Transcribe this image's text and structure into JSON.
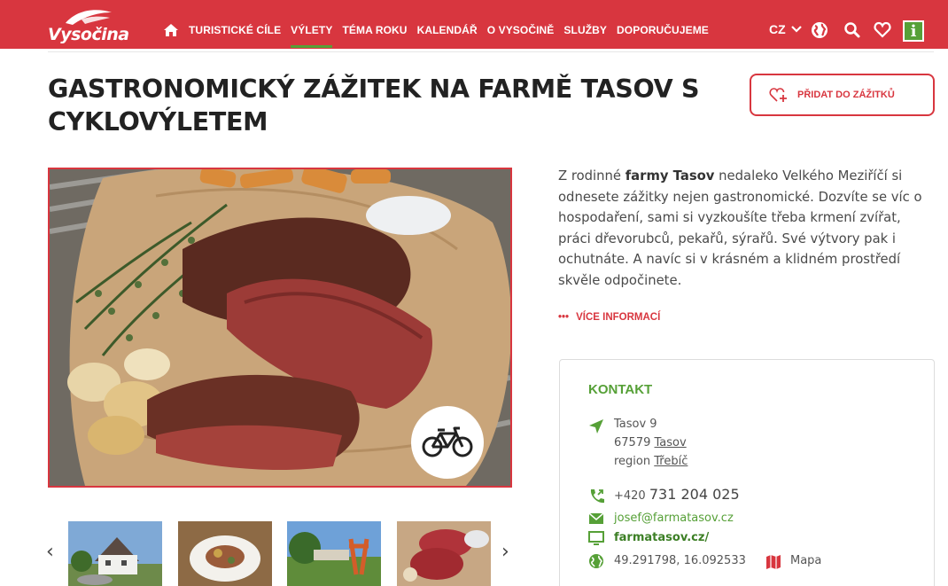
{
  "header": {
    "logo_text": "Vysočina",
    "nav": [
      "TURISTICKÉ CÍLE",
      "VÝLETY",
      "TÉMA ROKU",
      "KALENDÁŘ",
      "O VYSOČINĚ",
      "SLUŽBY",
      "DOPORUČUJEME"
    ],
    "active_nav": "VÝLETY",
    "language": "CZ",
    "info_glyph": "i"
  },
  "page": {
    "title": "GASTRONOMICKÝ ZÁŽITEK NA FARMĚ TASOV S CYKLOVÝLETEM",
    "add_button": "PŘIDAT DO ZÁŽITKŮ"
  },
  "description": {
    "pre": "Z rodinné ",
    "bold": "farmy Tasov",
    "post": " nedaleko Velkého Meziříčí si odnesete zážitky nejen gastronomické. Dozvíte se víc o hospodaření, sami si vyzkoušíte třeba krmení zvířat, práci dřevorubců, pekařů, sýrařů. Své výtvory pak i ochutnáte. A navíc si v krásném a klidném prostředí skvěle odpočinete.",
    "more_dots": "•••",
    "more_label": "VÍCE INFORMACÍ"
  },
  "contact": {
    "title": "KONTAKT",
    "street": "Tasov 9",
    "zip": "67579",
    "city": "Tasov",
    "region_label": "region",
    "region": "Třebíč",
    "phone_prefix": "+420",
    "phone_number": "731 204 025",
    "email": "josef@farmatasov.cz",
    "web": "farmatasov.cz/",
    "gps": "49.291798, 16.092533",
    "map_label": "Mapa"
  },
  "gallery": {
    "prev": "‹",
    "next": "›"
  },
  "colors": {
    "brand_red": "#d8363f",
    "brand_green": "#56a037"
  },
  "icons": [
    "home-icon",
    "chevron-down-icon",
    "globe-icon",
    "search-icon",
    "heart-icon",
    "info-icon",
    "heart-plus-icon",
    "bicycle-icon",
    "location-arrow-icon",
    "phone-icon",
    "envelope-icon",
    "monitor-icon",
    "globe-icon",
    "map-icon"
  ]
}
